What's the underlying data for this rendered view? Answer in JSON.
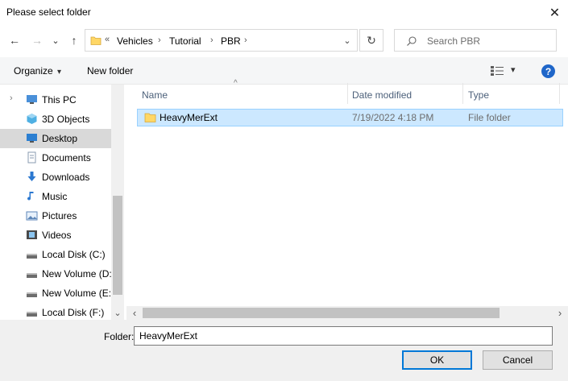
{
  "window": {
    "title": "Please select folder",
    "close_glyph": "✕"
  },
  "nav": {
    "back_glyph": "←",
    "forward_glyph": "→",
    "recent_glyph": "⌄",
    "up_glyph": "↑",
    "breadcrumb_overflow": "«",
    "breadcrumbs": [
      "Vehicles",
      "Tutorial",
      "PBR"
    ],
    "crumb_sep": "›",
    "dropdown_glyph": "⌄",
    "refresh_glyph": "↻",
    "search_placeholder": "Search PBR",
    "search_glyph": "⚲"
  },
  "toolbar": {
    "organize_label": "Organize",
    "organize_caret": "▾",
    "new_folder_label": "New folder",
    "view_caret": "▾",
    "help_glyph": "?"
  },
  "sidebar": {
    "items": [
      {
        "label": "This PC",
        "icon": "computer-icon"
      },
      {
        "label": "3D Objects",
        "icon": "cube-icon"
      },
      {
        "label": "Desktop",
        "icon": "desktop-icon",
        "selected": true
      },
      {
        "label": "Documents",
        "icon": "document-icon"
      },
      {
        "label": "Downloads",
        "icon": "download-icon"
      },
      {
        "label": "Music",
        "icon": "music-icon"
      },
      {
        "label": "Pictures",
        "icon": "picture-icon"
      },
      {
        "label": "Videos",
        "icon": "video-icon"
      },
      {
        "label": "Local Disk (C:)",
        "icon": "drive-icon"
      },
      {
        "label": "New Volume (D:",
        "icon": "drive-icon"
      },
      {
        "label": "New Volume (E:)",
        "icon": "drive-icon"
      },
      {
        "label": "Local Disk (F:)",
        "icon": "drive-icon"
      }
    ],
    "expand_glyph": "›"
  },
  "list": {
    "columns": [
      "Name",
      "Date modified",
      "Type"
    ],
    "sort_glyph": "^",
    "rows": [
      {
        "name": "HeavyMerExt",
        "date": "7/19/2022 4:18 PM",
        "type": "File folder"
      }
    ]
  },
  "scroll": {
    "up": "⌃",
    "down": "⌄",
    "left": "‹",
    "right": "›"
  },
  "footer": {
    "folder_label": "Folder:",
    "folder_value": "HeavyMerExt",
    "ok_label": "OK",
    "cancel_label": "Cancel"
  },
  "colors": {
    "selection": "#cce8ff",
    "selection_border": "#99d1ff",
    "folder": "#ffd766",
    "accent": "#0078d7"
  }
}
